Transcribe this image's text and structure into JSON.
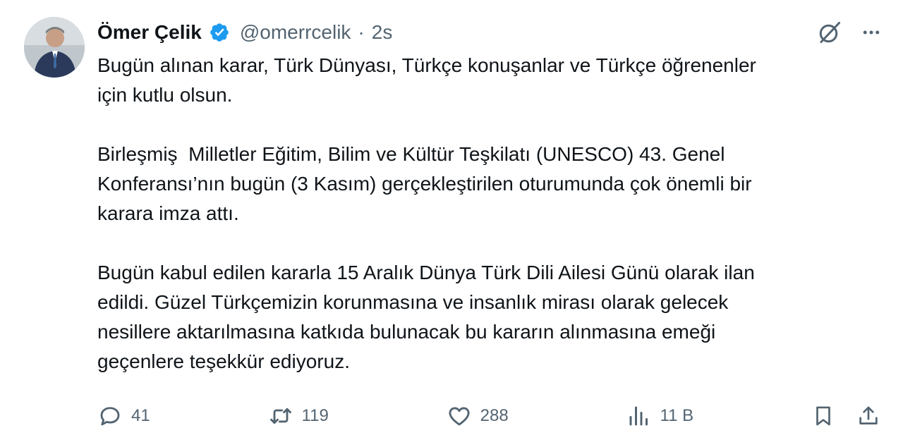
{
  "author": {
    "name": "Ömer Çelik",
    "handle": "@omerrcelik",
    "separator": "·",
    "time": "2s"
  },
  "tweet": {
    "paragraphs": [
      "Bugün alınan karar, Türk Dünyası, Türkçe konuşanlar ve Türkçe öğrenenler\niçin kutlu olsun.",
      "Birleşmiş  Milletler Eğitim, Bilim ve Kültür Teşkilatı (UNESCO) 43. Genel\nKonferansı’nın bugün (3 Kasım) gerçekleştirilen oturumunda çok önemli bir\nkarara imza attı.",
      "Bugün kabul edilen kararla 15 Aralık Dünya Türk Dili Ailesi Günü olarak ilan\nedildi. Güzel Türkçemizin korunmasına ve insanlık mirası olarak gelecek\nnesillere aktarılmasına katkıda bulunacak bu kararın alınmasına emeği\ngeçenlere teşekkür ediyoruz."
    ]
  },
  "stats": {
    "replies": "41",
    "reposts": "119",
    "likes": "288",
    "views": "11 B"
  },
  "icons": {
    "verified": "verified-badge-icon",
    "grok": "grok-icon",
    "more": "more-icon",
    "reply": "reply-icon",
    "repost": "repost-icon",
    "like": "heart-icon",
    "views": "views-icon",
    "bookmark": "bookmark-icon",
    "share": "share-icon"
  },
  "colors": {
    "text": "#0f1419",
    "secondary": "#536471",
    "verified": "#1d9bf0"
  }
}
